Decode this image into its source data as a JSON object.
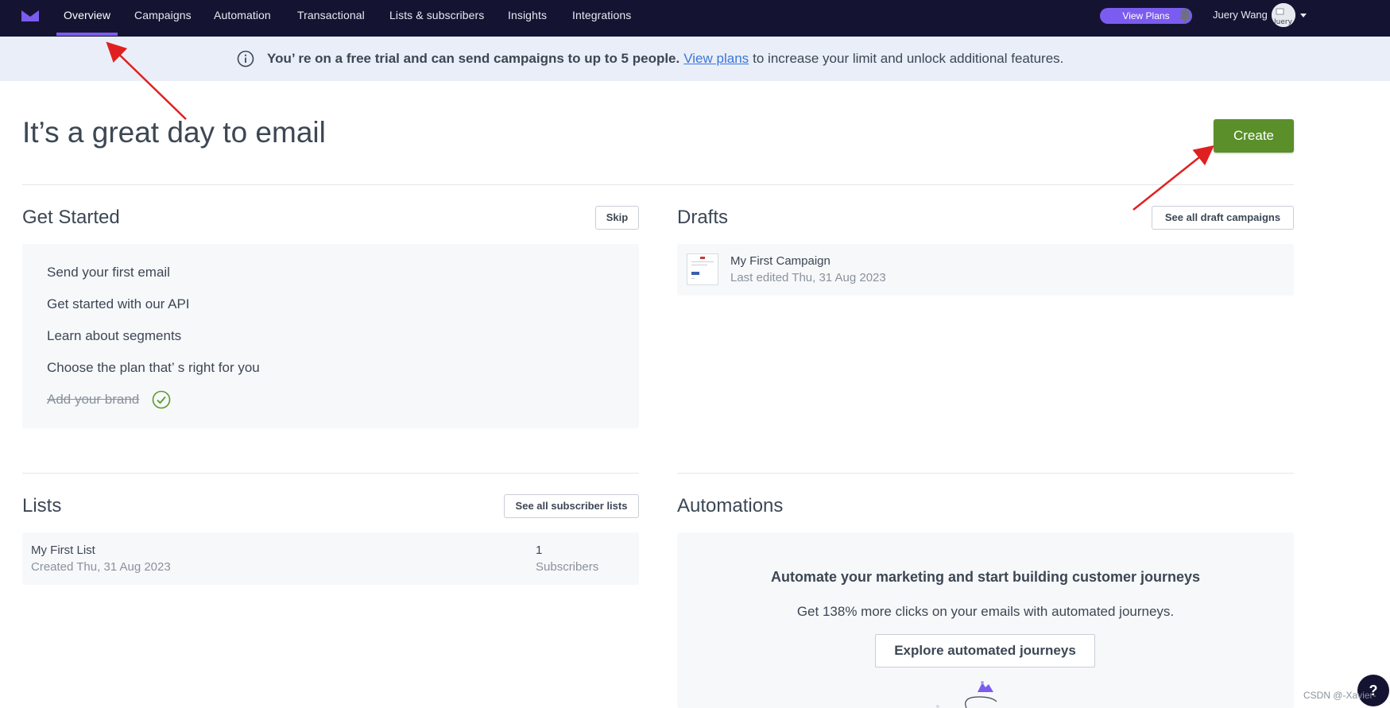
{
  "nav": {
    "items": [
      {
        "label": "Overview"
      },
      {
        "label": "Campaigns"
      },
      {
        "label": "Automation"
      },
      {
        "label": "Transactional"
      },
      {
        "label": "Lists & subscribers"
      },
      {
        "label": "Insights"
      },
      {
        "label": "Integrations"
      }
    ],
    "active_index": 0,
    "view_plans_label": "View Plans",
    "user_name": "Juery Wang",
    "avatar_alt": "Juery"
  },
  "banner": {
    "text_bold": "You’ re on a free trial and can send campaigns to up to 5 people.",
    "link_text": "View plans",
    "text_after": "to increase your limit and unlock additional features."
  },
  "page": {
    "title": "It’s a great day to email",
    "create_label": "Create"
  },
  "get_started": {
    "title": "Get Started",
    "skip_label": "Skip",
    "items": [
      {
        "label": "Send your first email",
        "done": false
      },
      {
        "label": "Get started with our API",
        "done": false
      },
      {
        "label": "Learn about segments",
        "done": false
      },
      {
        "label": "Choose the plan that’ s right for you",
        "done": false
      },
      {
        "label": "Add your brand",
        "done": true
      }
    ]
  },
  "drafts": {
    "title": "Drafts",
    "see_all_label": "See all draft campaigns",
    "items": [
      {
        "name": "My First Campaign",
        "meta": "Last edited Thu, 31 Aug 2023"
      }
    ]
  },
  "lists": {
    "title": "Lists",
    "see_all_label": "See all subscriber lists",
    "items": [
      {
        "name": "My First List",
        "created": "Created Thu, 31 Aug 2023",
        "count": "1",
        "count_label": "Subscribers"
      }
    ]
  },
  "automations": {
    "title": "Automations",
    "headline": "Automate your marketing and start building customer journeys",
    "subline": "Get 138% more clicks on your emails with automated journeys.",
    "button_label": "Explore automated journeys"
  },
  "help": {
    "label": "?"
  },
  "watermark": "CSDN @-Xavier-",
  "colors": {
    "nav_bg": "#141432",
    "accent": "#7b5cf0",
    "create_green": "#5a8f2a",
    "banner_bg": "#eaeef9",
    "link_blue": "#3a77d6",
    "annotation_red": "#e02020"
  }
}
